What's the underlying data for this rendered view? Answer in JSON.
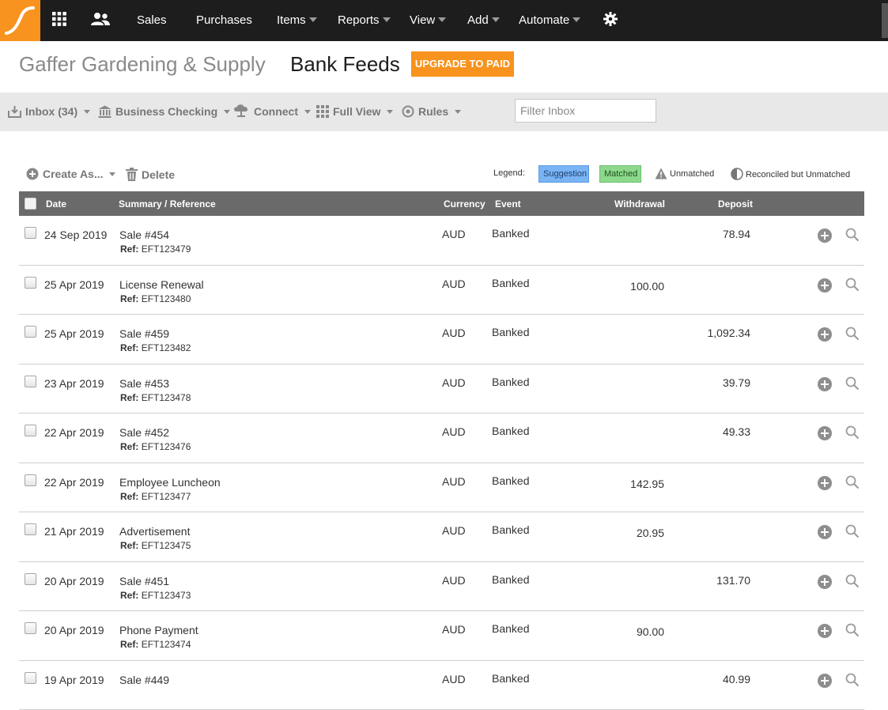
{
  "nav": {
    "items": [
      {
        "label": "Sales",
        "dropdown": false
      },
      {
        "label": "Purchases",
        "dropdown": false
      },
      {
        "label": "Items",
        "dropdown": true
      },
      {
        "label": "Reports",
        "dropdown": true
      },
      {
        "label": "View",
        "dropdown": true
      },
      {
        "label": "Add",
        "dropdown": true
      },
      {
        "label": "Automate",
        "dropdown": true
      }
    ],
    "icons": [
      "apps-grid-icon",
      "people-icon",
      "gear-icon"
    ],
    "brand_color": "#f7931e",
    "bar_color": "#1d1d1d"
  },
  "header": {
    "company": "Gaffer Gardening & Supply",
    "title": "Bank Feeds",
    "upgrade_label": "UPGRADE TO PAID"
  },
  "toolbar": {
    "inbox": "Inbox (34)",
    "account": "Business Checking",
    "connect": "Connect",
    "view": "Full View",
    "rules": "Rules",
    "filter_placeholder": "Filter Inbox"
  },
  "actions": {
    "create": "Create As...",
    "delete": "Delete"
  },
  "legend": {
    "label": "Legend:",
    "suggestion": "Suggestion",
    "matched": "Matched",
    "unmatched": "Unmatched",
    "reconciled": "Reconciled but Unmatched",
    "suggestion_color": "#79b4f5",
    "matched_color": "#8cd98c"
  },
  "table": {
    "headers": {
      "date": "Date",
      "summary": "Summary / Reference",
      "currency": "Currency",
      "event": "Event",
      "withdrawal": "Withdrawal",
      "deposit": "Deposit"
    },
    "ref_prefix": "Ref:",
    "rows": [
      {
        "date": "24 Sep 2019",
        "summary": "Sale #454",
        "ref": "EFT123479",
        "currency": "AUD",
        "event": "Banked",
        "withdrawal": "",
        "deposit": "78.94"
      },
      {
        "date": "25 Apr 2019",
        "summary": "License Renewal",
        "ref": "EFT123480",
        "currency": "AUD",
        "event": "Banked",
        "withdrawal": "100.00",
        "deposit": ""
      },
      {
        "date": "25 Apr 2019",
        "summary": "Sale #459",
        "ref": "EFT123482",
        "currency": "AUD",
        "event": "Banked",
        "withdrawal": "",
        "deposit": "1,092.34"
      },
      {
        "date": "23 Apr 2019",
        "summary": "Sale #453",
        "ref": "EFT123478",
        "currency": "AUD",
        "event": "Banked",
        "withdrawal": "",
        "deposit": "39.79"
      },
      {
        "date": "22 Apr 2019",
        "summary": "Sale #452",
        "ref": "EFT123476",
        "currency": "AUD",
        "event": "Banked",
        "withdrawal": "",
        "deposit": "49.33"
      },
      {
        "date": "22 Apr 2019",
        "summary": "Employee Luncheon",
        "ref": "EFT123477",
        "currency": "AUD",
        "event": "Banked",
        "withdrawal": "142.95",
        "deposit": ""
      },
      {
        "date": "21 Apr 2019",
        "summary": "Advertisement",
        "ref": "EFT123475",
        "currency": "AUD",
        "event": "Banked",
        "withdrawal": "20.95",
        "deposit": ""
      },
      {
        "date": "20 Apr 2019",
        "summary": "Sale #451",
        "ref": "EFT123473",
        "currency": "AUD",
        "event": "Banked",
        "withdrawal": "",
        "deposit": "131.70"
      },
      {
        "date": "20 Apr 2019",
        "summary": "Phone Payment",
        "ref": "EFT123474",
        "currency": "AUD",
        "event": "Banked",
        "withdrawal": "90.00",
        "deposit": ""
      },
      {
        "date": "19 Apr 2019",
        "summary": "Sale #449",
        "ref": "",
        "currency": "AUD",
        "event": "Banked",
        "withdrawal": "",
        "deposit": "40.99"
      }
    ]
  }
}
